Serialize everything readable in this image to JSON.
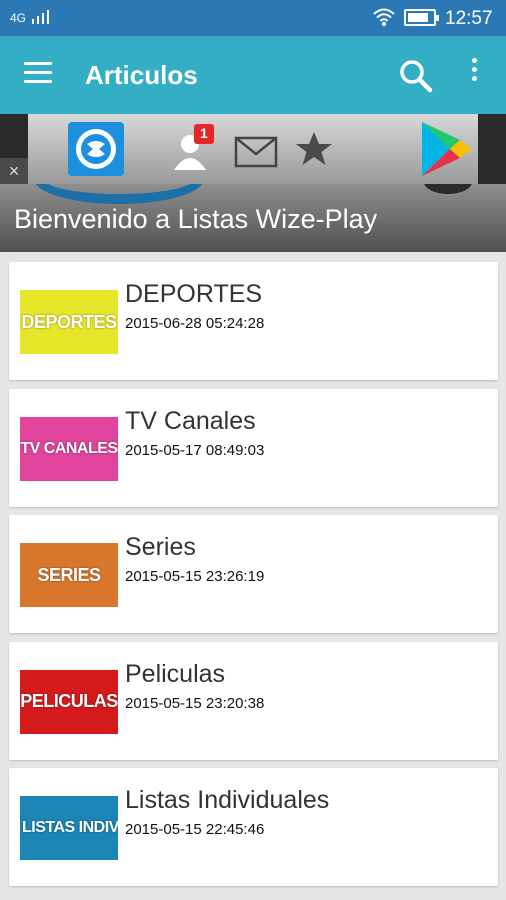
{
  "status_bar": {
    "network": "4G",
    "time": "12:57"
  },
  "app_bar": {
    "title": "Articulos"
  },
  "ad": {
    "close": "×",
    "notification_count": "1"
  },
  "banner": {
    "text": "Bienvenido a Listas Wize-Play"
  },
  "items": [
    {
      "thumb_label": "DEPORTES",
      "title": "DEPORTES",
      "date": "2015-06-28 05:24:28",
      "color": "#e6e62a",
      "text_color": "#ffffff"
    },
    {
      "thumb_label": "TV CANALES",
      "title": "TV Canales",
      "date": "2015-05-17 08:49:03",
      "color": "#e0449c",
      "text_color": "#ffffff"
    },
    {
      "thumb_label": "SERIES",
      "title": "Series",
      "date": "2015-05-15 23:26:19",
      "color": "#d8762c",
      "text_color": "#ffffff"
    },
    {
      "thumb_label": "PELICULAS",
      "title": "Peliculas",
      "date": "2015-05-15 23:20:38",
      "color": "#d41a1a",
      "text_color": "#ffffff"
    },
    {
      "thumb_label": "LISTAS INDIV",
      "title": "Listas Individuales",
      "date": "2015-05-15 22:45:46",
      "color": "#1b86b6",
      "text_color": "#ffffff"
    }
  ],
  "colors": {
    "status_bar": "#2c78b5",
    "app_bar": "#33aec4",
    "background": "#e6e6e6"
  }
}
